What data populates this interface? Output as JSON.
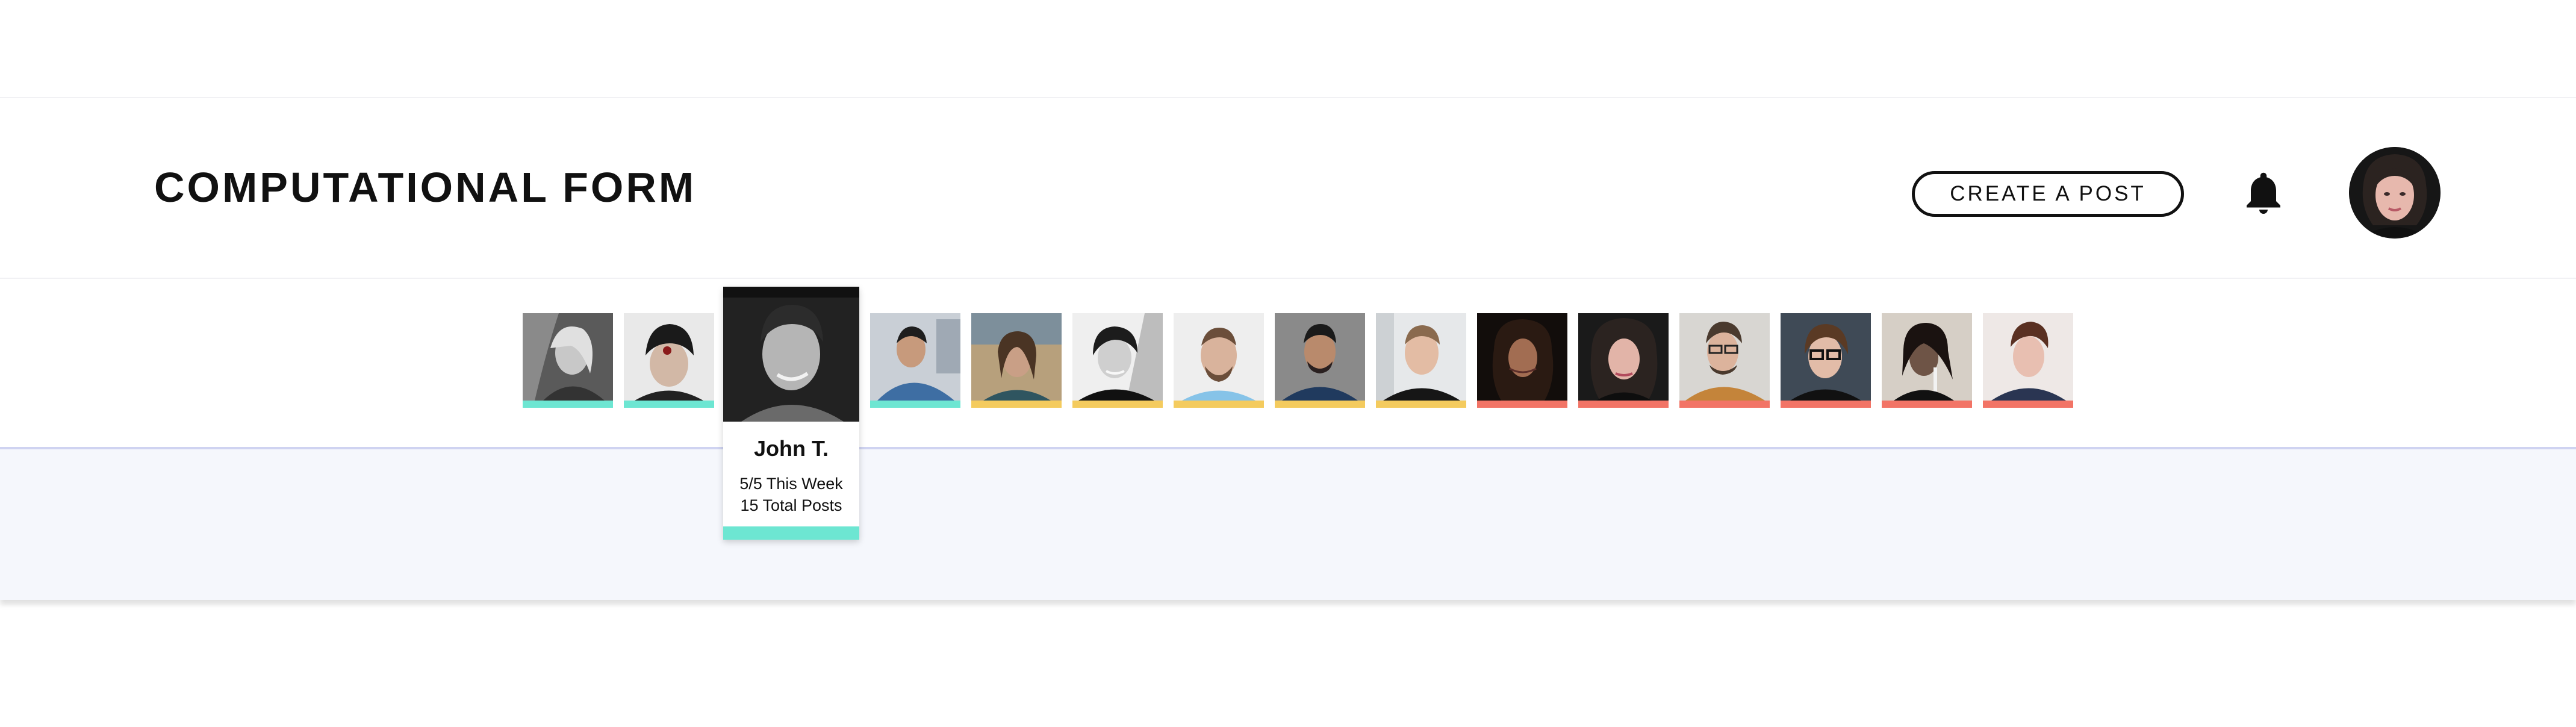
{
  "header": {
    "title": "COMPUTATIONAL FORM",
    "create_post_label": "CREATE A POST",
    "notification_icon": "bell-icon",
    "user_avatar_icon": "user-avatar"
  },
  "colors": {
    "teal": "#6de6d2",
    "yellow": "#f4cb5e",
    "coral": "#f27466",
    "strip_border": "#cfd3f1",
    "panel_background": "#f5f7fc"
  },
  "members": [
    {
      "status": "teal"
    },
    {
      "status": "teal"
    },
    {
      "status": "teal",
      "expanded": true,
      "name": "John T.",
      "week": "5/5 This Week",
      "total": "15 Total Posts"
    },
    {
      "status": "teal"
    },
    {
      "status": "yellow"
    },
    {
      "status": "yellow"
    },
    {
      "status": "yellow"
    },
    {
      "status": "yellow"
    },
    {
      "status": "yellow"
    },
    {
      "status": "coral"
    },
    {
      "status": "coral"
    },
    {
      "status": "coral"
    },
    {
      "status": "coral"
    },
    {
      "status": "coral"
    },
    {
      "status": "coral"
    }
  ]
}
